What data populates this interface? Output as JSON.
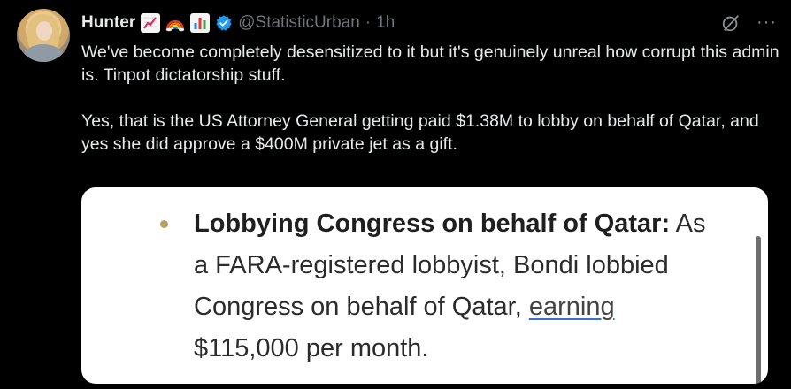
{
  "author": {
    "name": "Hunter",
    "emojis": [
      "chart-increasing-emoji",
      "rainbow-emoji",
      "bar-chart-emoji"
    ],
    "handle": "@StatisticUrban",
    "separator": "·",
    "time": "1h",
    "verified": true
  },
  "icons": {
    "grok": "grok-icon",
    "more": "more-icon",
    "more_glyph": "···"
  },
  "tweet": {
    "para1": "We've become completely desensitized to it but it's genuinely unreal how corrupt this admin is. Tinpot dictatorship stuff.",
    "para2": "Yes, that is the US Attorney General getting paid $1.38M to lobby on behalf of Qatar, and yes she did approve a $400M private jet as a gift."
  },
  "card": {
    "heading": "Lobbying Congress on behalf of Qatar:",
    "text_before_link": " As a FARA-registered lobbyist, Bondi lobbied Congress on behalf of Qatar, ",
    "link_text": "earning",
    "text_after_link": " $115,000 per month."
  },
  "colors": {
    "background": "#000000",
    "text": "#e7e9ea",
    "muted": "#71767b",
    "verified": "#1d9bf0",
    "card_bg": "#ffffff",
    "bullet": "#b7a35f"
  }
}
